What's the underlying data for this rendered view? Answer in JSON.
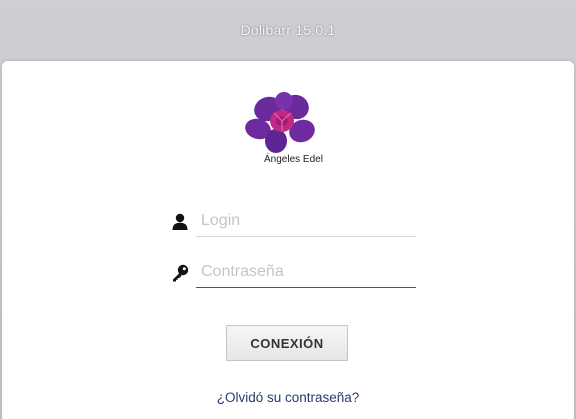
{
  "app": {
    "title": "Dolibarr 15.0.1"
  },
  "logo": {
    "text": "Ángeles Edel",
    "icon": "orchid-flower-logo",
    "petal_color": "#6a2a9c",
    "center_color": "#c02a86"
  },
  "form": {
    "login": {
      "icon": "user-icon",
      "placeholder": "Login",
      "value": ""
    },
    "password": {
      "icon": "key-icon",
      "placeholder": "Contraseña",
      "value": ""
    },
    "submit_label": "CONEXIÓN",
    "forgot_password_label": "¿Olvidó su contraseña?"
  }
}
